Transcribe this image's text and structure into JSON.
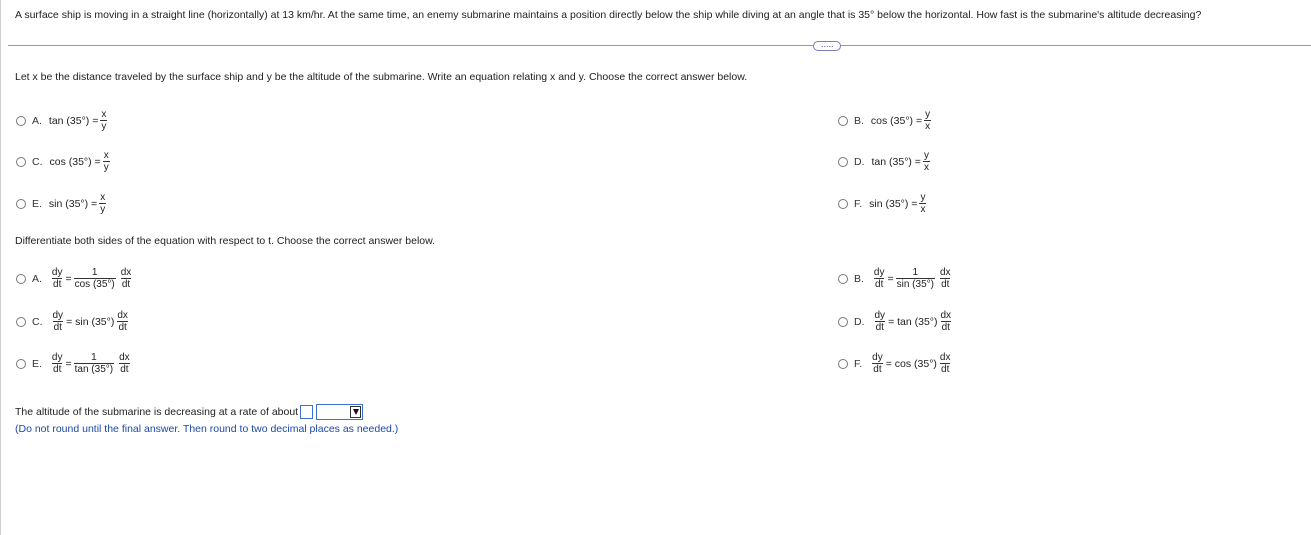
{
  "question": "A surface ship is moving in a straight line (horizontally) at 13 km/hr. At the same time, an enemy submarine maintains a position directly below the ship while diving at an angle that is 35° below the horizontal. How fast is the submarine's altitude decreasing?",
  "more_icon": "ellipsis-icon",
  "more_label": "·····",
  "part1": {
    "instruction": "Let x be the distance traveled by the surface ship and y be the altitude of the submarine. Write an equation relating x and y. Choose the correct answer below.",
    "options": [
      {
        "letter": "A.",
        "func": "tan (35°) =",
        "num": "x",
        "den": "y"
      },
      {
        "letter": "B.",
        "func": "cos (35°) =",
        "num": "y",
        "den": "x"
      },
      {
        "letter": "C.",
        "func": "cos (35°) =",
        "num": "x",
        "den": "y"
      },
      {
        "letter": "D.",
        "func": "tan (35°) =",
        "num": "y",
        "den": "x"
      },
      {
        "letter": "E.",
        "func": "sin (35°) =",
        "num": "x",
        "den": "y"
      },
      {
        "letter": "F.",
        "func": "sin (35°) =",
        "num": "y",
        "den": "x"
      }
    ]
  },
  "part2": {
    "instruction": "Differentiate both sides of the equation with respect to t. Choose the correct answer below.",
    "dy": "dy",
    "dt": "dt",
    "dx": "dx",
    "one": "1",
    "eq": "=",
    "options": [
      {
        "letter": "A.",
        "func": "cos (35°)"
      },
      {
        "letter": "B.",
        "func": "sin (35°)"
      },
      {
        "letter": "C.",
        "func": "= sin (35°)"
      },
      {
        "letter": "D.",
        "func": "= tan (35°)"
      },
      {
        "letter": "E.",
        "func": "tan (35°)"
      },
      {
        "letter": "F.",
        "func": "= cos (35°)"
      }
    ]
  },
  "answer": {
    "text": "The altitude of the submarine is decreasing at a rate of about",
    "input_value": "",
    "select_value": "",
    "note": "(Do not round until the final answer. Then round to two decimal places as needed.)"
  }
}
